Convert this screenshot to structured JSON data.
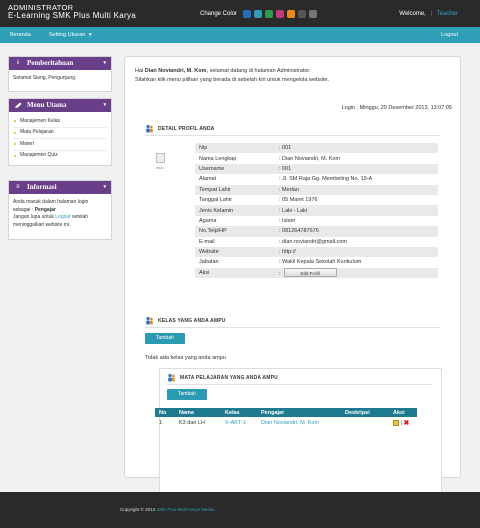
{
  "header": {
    "title_line1": "ADMINISTRATOR",
    "title_line2": "E-Learning SMK Plus Multi Karya",
    "change_color_label": "Change Color",
    "color_swatches": [
      "#1f6fbf",
      "#2e9fb6",
      "#2f9a4a",
      "#c23a7a",
      "#e88a1a",
      "#555555",
      "#777777"
    ],
    "welcome_label": "Welcome,",
    "separator": "|",
    "user_link": "Teacher"
  },
  "nav": {
    "home": "Beranda",
    "settings": "Setting Ukuran",
    "settings_caret": "▾",
    "logout": "Logout"
  },
  "sidebar": {
    "announcement": {
      "title": "Pemberitahuan",
      "icon": "info-icon",
      "text": "Selamat Siang, Pengunjung."
    },
    "menu": {
      "title": "Menu Utama",
      "icon": "pencil-icon",
      "items": [
        "Manajemen Kelas",
        "Mata Pelajaran",
        "Materi",
        "Manajemen Quiz"
      ]
    },
    "info": {
      "title": "Informasi",
      "icon": "hamburger-icon",
      "text_1": "Anda masuk dalam halaman login sebagai :",
      "role": "Pengajar",
      "text_2": "Jangan lupa untuk",
      "link": "Logout",
      "text_3": "setelah meninggalkan website ini."
    },
    "collapse_glyph": "▾"
  },
  "main": {
    "greeting_prefix": "Hai",
    "greeting_name": "Dian Noviandri, M. Kom",
    "greeting_suffix": ", selamat datang di halaman Administrator.",
    "instruction": "Silahkan klik menu pilihan yang berada di sebelah kiri untuk mengelola website.",
    "login_info": "Login : Minggu, 29 Desember 2013, 13:07:05",
    "profile_title": "DETAIL PROFIL ANDA",
    "photo_caption": "mun",
    "profile": [
      {
        "label": "Nip",
        "value": ": 001"
      },
      {
        "label": "Nama Lengkap",
        "value": ": Dian Noviandri, M. Kom"
      },
      {
        "label": "Username",
        "value": ": 001"
      },
      {
        "label": "Alamat",
        "value": ": Jl. SM Raja Gg. Membeling No. 19-A"
      },
      {
        "label": "Tempat Lahir",
        "value": ": Medan"
      },
      {
        "label": "Tanggal Lahir",
        "value": ": 05 Maret 1976"
      },
      {
        "label": "Jenis Kelamin",
        "value": ": Laki - Laki"
      },
      {
        "label": "Agama",
        "value": ": Islam"
      },
      {
        "label": "No.Telp/HP",
        "value": ": 081264787676"
      },
      {
        "label": "E-mail",
        "value": ": dian.noviandri@gmail.com"
      },
      {
        "label": "Website",
        "value": ": http://"
      },
      {
        "label": "Jabatan",
        "value": ": Wakil Kepala Sekolah Kurikulum"
      },
      {
        "label": "Aksi",
        "value": ":"
      }
    ],
    "edit_profile_button": "Edit Profil",
    "kelas_title": "KELAS YANG ANDA AMPU",
    "add_class_button": "Tambah",
    "no_class_text": "Tidak ada kelas yang anda ampu",
    "mapel_title": "MATA PELAJARAN YANG ANDA AMPU",
    "add_subject_button": "Tambah",
    "table": {
      "headers": [
        "No",
        "Nama",
        "Kelas",
        "Pengajar",
        "Deskripsi",
        "Aksi"
      ],
      "rows": [
        {
          "no": "1",
          "nama": "K3 dan LH",
          "kelas": "X-AKT-1",
          "pengajar": "Dian Noviandri, M. Kom",
          "deskripsi": "",
          "sep": "|"
        }
      ]
    }
  },
  "footer": {
    "prefix": "Copyright © 2013",
    "link": "SMK Plus Multi Karya Medan"
  }
}
